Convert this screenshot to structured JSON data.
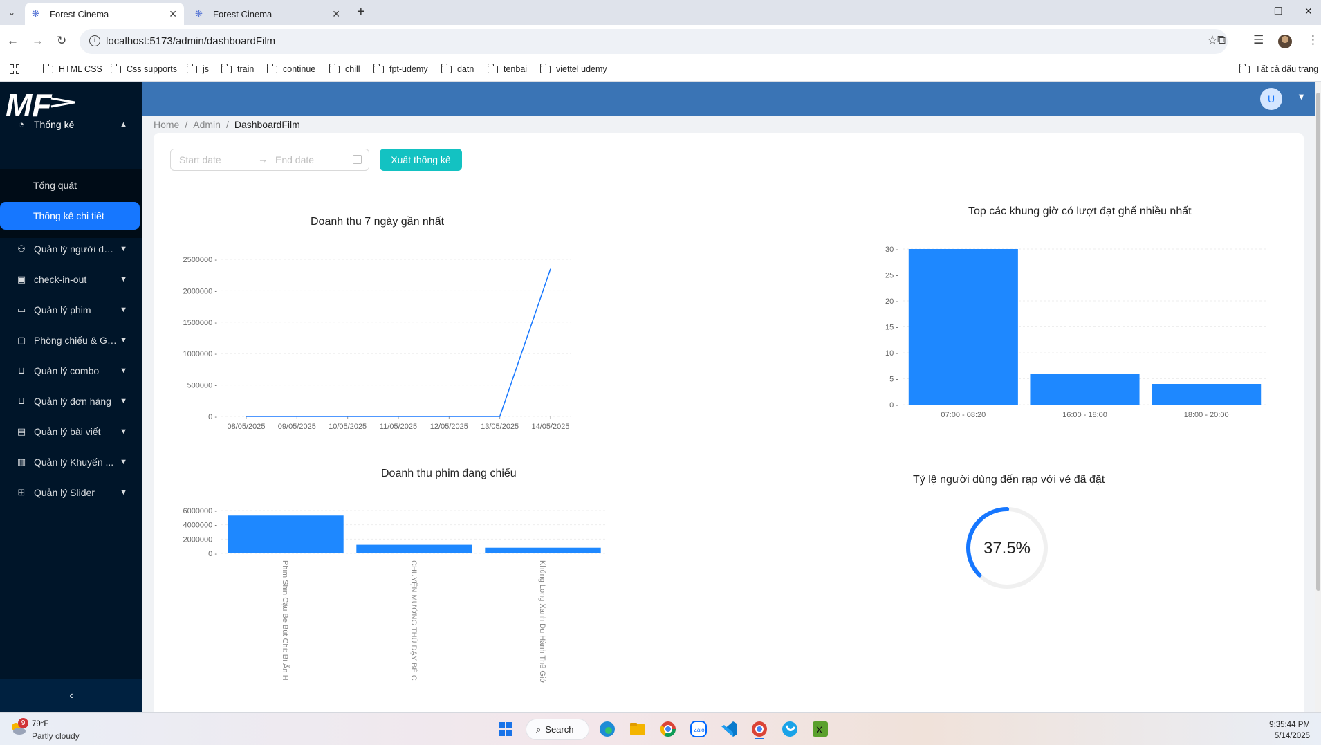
{
  "browser": {
    "tabs": [
      {
        "title": "Forest Cinema",
        "active": true
      },
      {
        "title": "Forest Cinema",
        "active": false
      }
    ],
    "url": "localhost:5173/admin/dashboardFilm",
    "bookmarks": [
      "HTML CSS",
      "Css supports",
      "js",
      "train",
      "continue",
      "chill",
      "fpt-udemy",
      "datn",
      "tenbai",
      "viettel udemy"
    ],
    "all_bookmarks": "Tất cả dấu trang"
  },
  "sidebar": {
    "logo_text": "MF",
    "group_stats": "Thống kê",
    "sub_items": [
      "Tổng quát",
      "Thống kê chi tiết"
    ],
    "items": [
      {
        "label": "Quản lý người dù...",
        "icon": "user-icon"
      },
      {
        "label": "check-in-out",
        "icon": "calendar-icon"
      },
      {
        "label": "Quản lý phim",
        "icon": "video-icon"
      },
      {
        "label": "Phòng chiếu & Gi...",
        "icon": "desktop-icon"
      },
      {
        "label": "Quản lý combo",
        "icon": "shopping-icon"
      },
      {
        "label": "Quản lý đơn hàng",
        "icon": "shopping-icon"
      },
      {
        "label": "Quản lý bài viết",
        "icon": "file-icon"
      },
      {
        "label": "Quản lý Khuyến ...",
        "icon": "barcode-icon"
      },
      {
        "label": "Quản lý Slider",
        "icon": "appstore-icon"
      }
    ],
    "collapse_glyph": "‹"
  },
  "header": {
    "avatar_letter": "U"
  },
  "breadcrumb": [
    "Home",
    "Admin",
    "DashboardFilm"
  ],
  "filters": {
    "start_placeholder": "Start date",
    "end_placeholder": "End date",
    "export_label": "Xuất thống kê"
  },
  "charts": {
    "revenue7_title": "Doanh thu 7 ngày gần nhất",
    "top_slots_title": "Top các khung giờ có lượt đạt ghế nhiều nhất",
    "movie_revenue_title": "Doanh thu phim đang chiếu",
    "ratio_title": "Tỷ lệ người dùng đến rạp với vé đã đặt",
    "ratio_value": "37.5%"
  },
  "chart_data": [
    {
      "type": "line",
      "title": "Doanh thu 7 ngày gần nhất",
      "x": [
        "08/05/2025",
        "09/05/2025",
        "10/05/2025",
        "11/05/2025",
        "12/05/2025",
        "13/05/2025",
        "14/05/2025"
      ],
      "y": [
        0,
        0,
        0,
        0,
        0,
        0,
        2350000
      ],
      "yticks": [
        0,
        500000,
        1000000,
        1500000,
        2000000,
        2500000
      ],
      "ylim": [
        0,
        2500000
      ],
      "color": "#1677ff"
    },
    {
      "type": "bar",
      "title": "Top các khung giờ có lượt đạt ghế nhiều nhất",
      "categories": [
        "07:00 - 08:20",
        "16:00 - 18:00",
        "18:00 - 20:00"
      ],
      "values": [
        30,
        6,
        4
      ],
      "yticks": [
        0,
        5,
        10,
        15,
        20,
        25,
        30
      ],
      "ylim": [
        0,
        30
      ],
      "color": "#1e88ff"
    },
    {
      "type": "bar",
      "title": "Doanh thu phim đang chiếu",
      "categories": [
        "Phim Shin Cậu Bé Bút Chì: Bí Ẩn H",
        "CHUYỆN MƯỜNG THÚ DẠY BÉ C",
        "Khủng Long Xanh Du Hành Thế Giớ"
      ],
      "values": [
        5300000,
        1200000,
        800000
      ],
      "yticks": [
        0,
        2000000,
        4000000,
        6000000
      ],
      "ylim": [
        0,
        6000000
      ],
      "color": "#1e88ff"
    },
    {
      "type": "pie",
      "title": "Tỷ lệ người dùng đến rạp với vé đã đặt",
      "value_percent": 37.5,
      "label": "37.5%",
      "color": "#1677ff",
      "track_color": "#f0f0f0"
    }
  ],
  "taskbar": {
    "temp": "79°F",
    "weather": "Partly cloudy",
    "badge": "9",
    "search": "Search",
    "time": "9:35:44 PM",
    "date": "5/14/2025"
  }
}
